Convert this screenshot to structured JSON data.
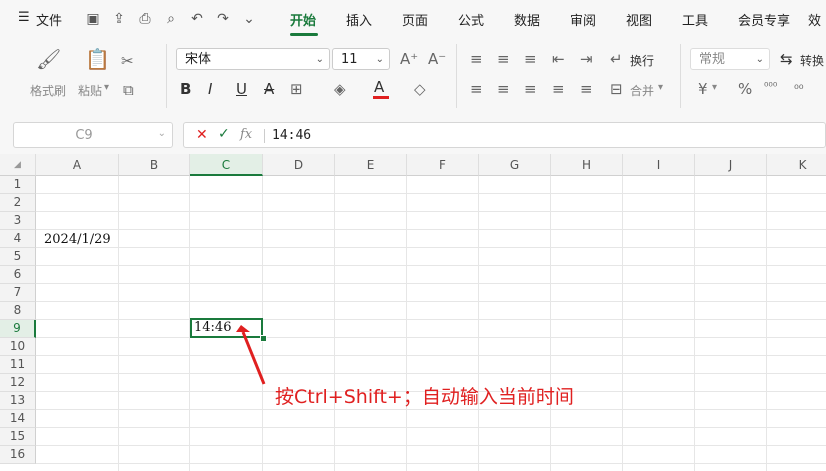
{
  "menu": {
    "file": "文件",
    "tabs": [
      "开始",
      "插入",
      "页面",
      "公式",
      "数据",
      "审阅",
      "视图",
      "工具",
      "会员专享",
      "效"
    ],
    "active_tab": "开始"
  },
  "ribbon": {
    "format_painter": "格式刷",
    "paste": "粘贴",
    "font_name": "宋体",
    "font_size": "11",
    "wrap": "换行",
    "merge": "合并",
    "number_format": "常规",
    "convert": "转换",
    "currency": "¥",
    "percent": "%",
    "font_color": "#e02020"
  },
  "formula_bar": {
    "cell_ref": "C9",
    "fx": "fx",
    "value": "14:46"
  },
  "grid": {
    "columns": [
      "A",
      "B",
      "C",
      "D",
      "E",
      "F",
      "G",
      "H",
      "I",
      "J",
      "K"
    ],
    "rows": [
      "1",
      "2",
      "3",
      "4",
      "5",
      "6",
      "7",
      "8",
      "9",
      "10",
      "11",
      "12",
      "13",
      "14",
      "15",
      "16"
    ],
    "selected_column": "C",
    "selected_row": "9",
    "cells": {
      "A4": "2024/1/29",
      "C9": "14:46"
    }
  },
  "annotation": {
    "text": "按Ctrl+Shift+；自动输入当前时间",
    "color": "#e02020"
  },
  "colors": {
    "accent": "#1a7a3c"
  }
}
